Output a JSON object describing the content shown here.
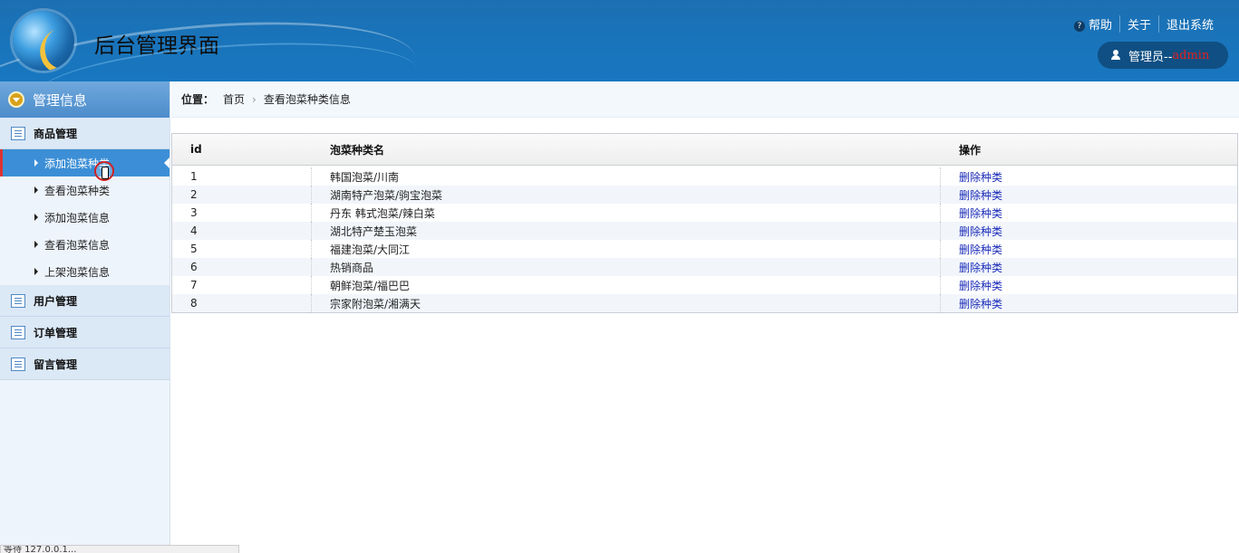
{
  "header": {
    "title": "后台管理界面",
    "links": [
      {
        "label": "帮助",
        "icon": "help-icon"
      },
      {
        "label": "关于"
      },
      {
        "label": "退出系统"
      }
    ],
    "user_prefix": "管理员--",
    "user_name": "admin"
  },
  "sidebar": {
    "head": "管理信息",
    "groups": [
      {
        "label": "商品管理",
        "items": [
          "添加泡菜种类",
          "查看泡菜种类",
          "添加泡菜信息",
          "查看泡菜信息",
          "上架泡菜信息"
        ]
      },
      {
        "label": "用户管理"
      },
      {
        "label": "订单管理"
      },
      {
        "label": "留言管理"
      }
    ],
    "active_item": "添加泡菜种类"
  },
  "breadcrumb": {
    "label": "位置：",
    "home": "首页",
    "current": "查看泡菜种类信息"
  },
  "table": {
    "headers": [
      "id",
      "泡菜种类名",
      "操作"
    ],
    "rows": [
      {
        "id": "1",
        "name": "韩国泡菜/川南",
        "action": "删除种类"
      },
      {
        "id": "2",
        "name": "湖南特产泡菜/驹宝泡菜",
        "action": "删除种类"
      },
      {
        "id": "3",
        "name": "丹东 韩式泡菜/辣白菜",
        "action": "删除种类"
      },
      {
        "id": "4",
        "name": "湖北特产楚玉泡菜",
        "action": "删除种类"
      },
      {
        "id": "5",
        "name": "福建泡菜/大同江",
        "action": "删除种类"
      },
      {
        "id": "6",
        "name": "热销商品",
        "action": "删除种类"
      },
      {
        "id": "7",
        "name": "朝鲜泡菜/福巴巴",
        "action": "删除种类"
      },
      {
        "id": "8",
        "name": "宗家附泡菜/湘满天",
        "action": "删除种类"
      }
    ]
  },
  "statusbar": {
    "text": "等待 127.0.0.1..."
  },
  "colors": {
    "header_blue": "#1a73b9",
    "active_item": "#3c8fd6",
    "link": "#1a2bb8",
    "admin_red": "#e02020"
  }
}
